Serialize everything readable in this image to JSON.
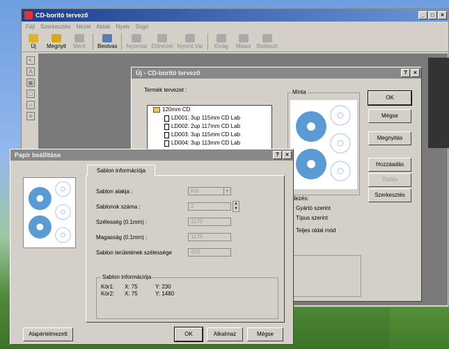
{
  "main": {
    "title": "CD-borító tervező",
    "menu": [
      "Fájl",
      "Szerkesztés",
      "Nézet",
      "Ablak",
      "Nyelv",
      "Súgó"
    ],
    "toolbar": [
      {
        "label": "Új",
        "icon": "new-icon",
        "enabled": true
      },
      {
        "label": "Megnyit",
        "icon": "open-folder-icon",
        "enabled": true
      },
      {
        "label": "Ment",
        "icon": "save-icon",
        "enabled": false
      },
      {
        "label": "Beolvas",
        "icon": "scan-icon",
        "enabled": true
      },
      {
        "label": "Nyomtat",
        "icon": "print-icon",
        "enabled": false
      },
      {
        "label": "Előnézet",
        "icon": "preview-icon",
        "enabled": false
      },
      {
        "label": "Nyomt.Var",
        "icon": "print-setup-icon",
        "enabled": false
      },
      {
        "label": "Kivág",
        "icon": "cut-icon",
        "enabled": false
      },
      {
        "label": "Másol",
        "icon": "copy-icon",
        "enabled": false
      },
      {
        "label": "Beilleszt",
        "icon": "paste-icon",
        "enabled": false
      }
    ]
  },
  "uj_dialog": {
    "title": "Új - CD-borító tervező",
    "help": "?",
    "close": "×",
    "termek_label": "Termék tervezet :",
    "minta_label": "Minta",
    "tree_root": "120mm CD",
    "tree_items": [
      "LD001: 3up 115mm CD Lab",
      "LD002: 2up 117mm CD Lab",
      "LD003: 3up 115mm CD Lab",
      "LD004: 3up 113mm CD Lab"
    ],
    "buttons": {
      "ok": "OK",
      "megse": "Mégse",
      "megnyitas": "Megnyitás",
      "hozzaadas": "Hozzáadás",
      "torles": "Törlés",
      "szerkesztes": "Szerkesztés"
    },
    "rendezes_label": "endezés:",
    "radios": [
      "Gyártó szerint",
      "Típus szerint",
      "Teljes oldal mód"
    ]
  },
  "papir_dialog": {
    "title": "Papír beállítása",
    "help": "?",
    "close": "×",
    "tab": "Sablon információja",
    "fields": [
      {
        "label": "Sablon alakja :",
        "value": "Kör"
      },
      {
        "label": "Sablonok száma :",
        "value": "2"
      },
      {
        "label": "Szélesség (0.1mm) :",
        "value": "1170"
      },
      {
        "label": "Magasság (0.1mm) :",
        "value": "1170"
      },
      {
        "label": "Sablon területének szélessége",
        "value": "450"
      }
    ],
    "info_group_title": "Sablon információja",
    "info_rows": [
      {
        "name": "Kör1:",
        "x": "X: 75",
        "y": "Y: 230"
      },
      {
        "name": "Kör2:",
        "x": "X: 75",
        "y": "Y: 1480"
      }
    ],
    "buttons": {
      "alapertelmezett": "Alapértelmezett",
      "ok": "OK",
      "alkalmaz": "Alkalmaz",
      "megse": "Mégse"
    }
  },
  "colors": {
    "disc_blue": "#5b9bd5",
    "title_active": "#0a246a",
    "title_inactive": "#888888"
  }
}
